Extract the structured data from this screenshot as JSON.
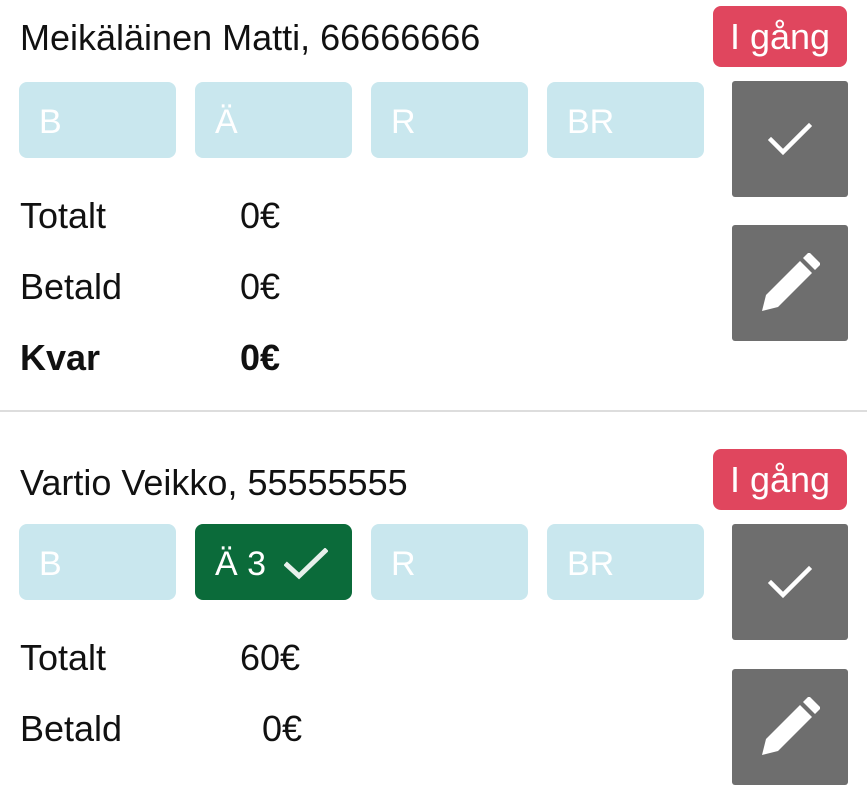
{
  "colors": {
    "status_badge_bg": "#e0465e",
    "chip_inactive_bg": "#c9e7ee",
    "chip_active_bg": "#0b6b3a",
    "action_button_bg": "#6e6e6e",
    "divider": "#dddddd"
  },
  "labels": {
    "total": "Totalt",
    "paid": "Betald",
    "remaining": "Kvar"
  },
  "orders": [
    {
      "customer": "Meikäläinen Matti, 66666666",
      "status": "I gång",
      "chips": [
        {
          "label": "B",
          "active": false
        },
        {
          "label": "Ä",
          "active": false
        },
        {
          "label": "R",
          "active": false
        },
        {
          "label": "BR",
          "active": false
        }
      ],
      "total": "0€",
      "paid": "0€",
      "remaining": "0€",
      "confirm_icon": "check-icon",
      "edit_icon": "pencil-icon"
    },
    {
      "customer": "Vartio Veikko, 55555555",
      "status": "I gång",
      "chips": [
        {
          "label": "B",
          "active": false
        },
        {
          "label": "Ä 3",
          "active": true,
          "icon": "check-icon"
        },
        {
          "label": "R",
          "active": false
        },
        {
          "label": "BR",
          "active": false
        }
      ],
      "total": "60€",
      "paid": "0€",
      "remaining": "",
      "confirm_icon": "check-icon",
      "edit_icon": "pencil-icon"
    }
  ]
}
